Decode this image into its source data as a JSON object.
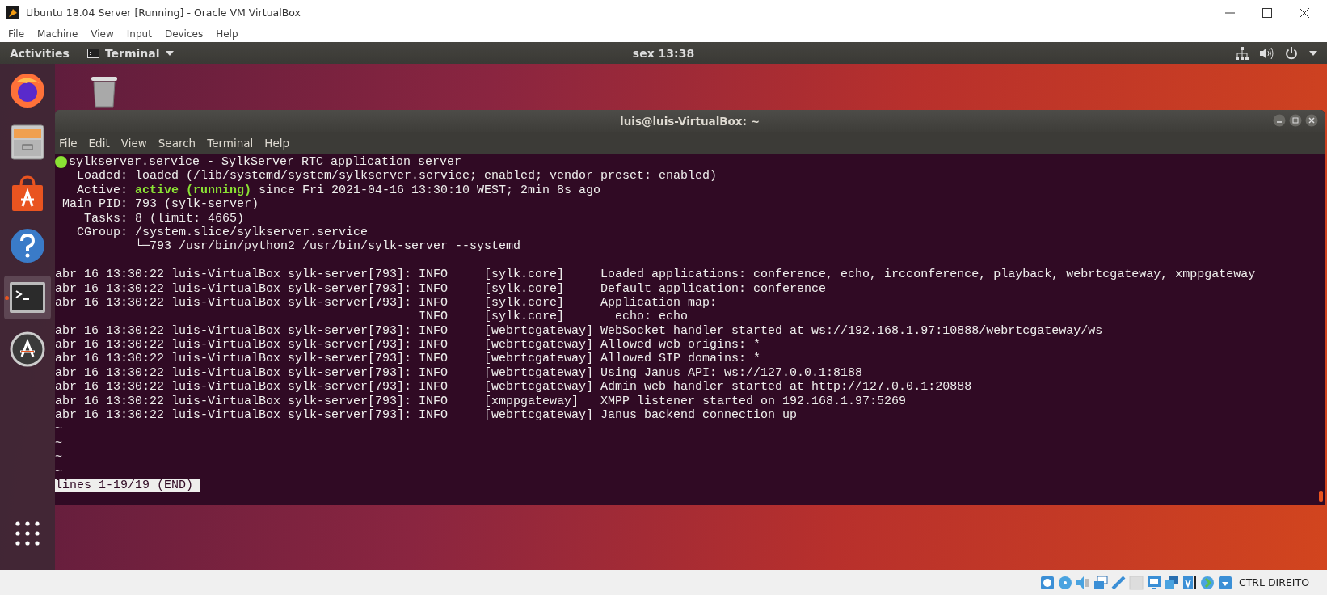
{
  "vbox_window": {
    "title": "Ubuntu 18.04 Server [Running] - Oracle VM VirtualBox",
    "menu": [
      "File",
      "Machine",
      "View",
      "Input",
      "Devices",
      "Help"
    ],
    "host_key": "CTRL DIREITO"
  },
  "top_bar": {
    "activities": "Activities",
    "app_menu": "Terminal",
    "clock": "sex 13:38"
  },
  "dock": [
    {
      "kind": "firefox",
      "selected": false,
      "running": false
    },
    {
      "kind": "files",
      "selected": false,
      "running": false
    },
    {
      "kind": "software",
      "selected": false,
      "running": false
    },
    {
      "kind": "help",
      "selected": false,
      "running": false
    },
    {
      "kind": "terminal",
      "selected": true,
      "running": true
    },
    {
      "kind": "updater",
      "selected": false,
      "running": false
    }
  ],
  "terminal": {
    "title": "luis@luis-VirtualBox: ~",
    "menu": [
      "File",
      "Edit",
      "View",
      "Search",
      "Terminal",
      "Help"
    ],
    "unit": {
      "active": true,
      "header": "sylkserver.service - SylkServer RTC application server"
    },
    "status_lines": [
      {
        "label": "Loaded:",
        "value": "loaded (/lib/systemd/system/sylkserver.service; enabled; vendor preset: enabled)"
      },
      {
        "label": "Active:",
        "state": "active (running)",
        "value": "since Fri 2021-04-16 13:30:10 WEST; 2min 8s ago"
      },
      {
        "label": "Main PID:",
        "value": "793 (sylk-server)"
      },
      {
        "label": "Tasks:",
        "value": "8 (limit: 4665)"
      },
      {
        "label": "CGroup:",
        "value": "/system.slice/sylkserver.service"
      }
    ],
    "tree_line": "└─793 /usr/bin/python2 /usr/bin/sylk-server --systemd",
    "log": [
      {
        "date": "abr 16 13:30:22",
        "host": "luis-VirtualBox",
        "process": "sylk-server[793]:",
        "level": "INFO",
        "module": "[sylk.core]",
        "message": "Loaded applications: conference, echo, ircconference, playback, webrtcgateway, xmppgateway"
      },
      {
        "date": "abr 16 13:30:22",
        "host": "luis-VirtualBox",
        "process": "sylk-server[793]:",
        "level": "INFO",
        "module": "[sylk.core]",
        "message": "Default application: conference"
      },
      {
        "date": "abr 16 13:30:22",
        "host": "luis-VirtualBox",
        "process": "sylk-server[793]:",
        "level": "INFO",
        "module": "[sylk.core]",
        "message": "Application map:"
      },
      {
        "level": "INFO",
        "module": "[sylk.core]",
        "message": "  echo: echo"
      },
      {
        "date": "abr 16 13:30:22",
        "host": "luis-VirtualBox",
        "process": "sylk-server[793]:",
        "level": "INFO",
        "module": "[webrtcgateway]",
        "message": "WebSocket handler started at ws://192.168.1.97:10888/webrtcgateway/ws"
      },
      {
        "date": "abr 16 13:30:22",
        "host": "luis-VirtualBox",
        "process": "sylk-server[793]:",
        "level": "INFO",
        "module": "[webrtcgateway]",
        "message": "Allowed web origins: *"
      },
      {
        "date": "abr 16 13:30:22",
        "host": "luis-VirtualBox",
        "process": "sylk-server[793]:",
        "level": "INFO",
        "module": "[webrtcgateway]",
        "message": "Allowed SIP domains: *"
      },
      {
        "date": "abr 16 13:30:22",
        "host": "luis-VirtualBox",
        "process": "sylk-server[793]:",
        "level": "INFO",
        "module": "[webrtcgateway]",
        "message": "Using Janus API: ws://127.0.0.1:8188"
      },
      {
        "date": "abr 16 13:30:22",
        "host": "luis-VirtualBox",
        "process": "sylk-server[793]:",
        "level": "INFO",
        "module": "[webrtcgateway]",
        "message": "Admin web handler started at http://127.0.0.1:20888"
      },
      {
        "date": "abr 16 13:30:22",
        "host": "luis-VirtualBox",
        "process": "sylk-server[793]:",
        "level": "INFO",
        "module": "[xmppgateway]",
        "message": "XMPP listener started on 192.168.1.97:5269"
      },
      {
        "date": "abr 16 13:30:22",
        "host": "luis-VirtualBox",
        "process": "sylk-server[793]:",
        "level": "INFO",
        "module": "[webrtcgateway]",
        "message": "Janus backend connection up"
      }
    ],
    "filler": [
      "~",
      "~",
      "~",
      "~"
    ],
    "pager_status": "lines 1-19/19 (END)"
  }
}
